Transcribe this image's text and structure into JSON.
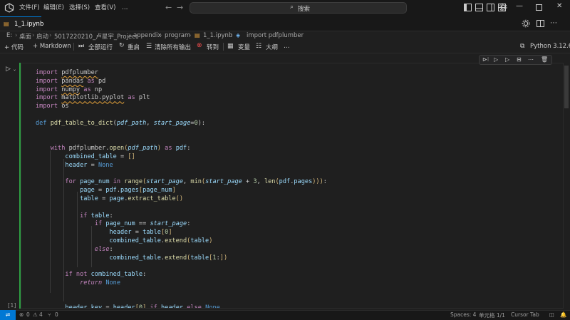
{
  "menu": [
    "文件(F)",
    "编辑(E)",
    "选择(S)",
    "查看(V)",
    "…"
  ],
  "search": {
    "placeholder": "搜索"
  },
  "tab": {
    "label": "1_1.ipynb"
  },
  "breadcrumb": [
    "E:",
    "桌面",
    "启动",
    "5017220210_卢星宇_Project",
    "appendix",
    "program",
    "1_1.ipynb",
    "import pdfplumber"
  ],
  "toolbar": {
    "add_code": "+ 代码",
    "add_markdown": "+ Markdown",
    "run_all": "全部运行",
    "restart": "重启",
    "clear_outputs": "清除所有输出",
    "goto": "转到",
    "variables": "变量",
    "outline": "大纲",
    "more": "…",
    "kernel": "Python 3.12.6"
  },
  "cell": {
    "exec_count": "[1]"
  },
  "code_lines": [
    [
      [
        "kw",
        "import "
      ],
      [
        "plain squig",
        "pdfplumber"
      ]
    ],
    [
      [
        "kw",
        "import "
      ],
      [
        "plain squig",
        "pandas"
      ],
      [
        "kw",
        " as "
      ],
      [
        "plain",
        "pd"
      ]
    ],
    [
      [
        "kw",
        "import "
      ],
      [
        "plain squig",
        "numpy"
      ],
      [
        "kw",
        " as "
      ],
      [
        "plain",
        "np"
      ]
    ],
    [
      [
        "kw",
        "import "
      ],
      [
        "plain squig",
        "matplotlib.pyplot"
      ],
      [
        "kw",
        " as "
      ],
      [
        "plain",
        "plt"
      ]
    ],
    [
      [
        "kw",
        "import "
      ],
      [
        "plain",
        "os"
      ]
    ],
    [],
    [
      [
        "kw2",
        "def "
      ],
      [
        "fn",
        "pdf_table_to_dict"
      ],
      [
        "plain",
        "("
      ],
      [
        "var it",
        "pdf_path"
      ],
      [
        "plain",
        ", "
      ],
      [
        "var it",
        "start_page"
      ],
      [
        "plain",
        "="
      ],
      [
        "num",
        "0"
      ],
      [
        "plain",
        "):"
      ]
    ],
    [],
    [],
    [
      [
        "plain",
        "    "
      ],
      [
        "kw",
        "with "
      ],
      [
        "plain",
        "pdfplumber."
      ],
      [
        "fn",
        "open"
      ],
      [
        "par",
        "("
      ],
      [
        "var it",
        "pdf_path"
      ],
      [
        "par",
        ")"
      ],
      [
        "kw",
        " as "
      ],
      [
        "var",
        "pdf"
      ],
      [
        "plain",
        ":"
      ]
    ],
    [
      [
        "plain",
        "        "
      ],
      [
        "var",
        "combined_table"
      ],
      [
        "plain",
        " = "
      ],
      [
        "par",
        "[]"
      ]
    ],
    [
      [
        "plain",
        "        "
      ],
      [
        "var",
        "header"
      ],
      [
        "plain",
        " = "
      ],
      [
        "kw2",
        "None"
      ]
    ],
    [],
    [
      [
        "plain",
        "        "
      ],
      [
        "kw",
        "for "
      ],
      [
        "var",
        "page_num"
      ],
      [
        "kw",
        " in "
      ],
      [
        "fn",
        "range"
      ],
      [
        "par",
        "("
      ],
      [
        "var it",
        "start_page"
      ],
      [
        "plain",
        ", "
      ],
      [
        "fn",
        "min"
      ],
      [
        "par",
        "("
      ],
      [
        "var it",
        "start_page"
      ],
      [
        "plain",
        " + "
      ],
      [
        "num",
        "3"
      ],
      [
        "plain",
        ", "
      ],
      [
        "fn",
        "len"
      ],
      [
        "par",
        "("
      ],
      [
        "var",
        "pdf"
      ],
      [
        "plain",
        "."
      ],
      [
        "var",
        "pages"
      ],
      [
        "par",
        ")))"
      ],
      [
        "plain",
        ":"
      ]
    ],
    [
      [
        "plain",
        "            "
      ],
      [
        "var",
        "page"
      ],
      [
        "plain",
        " = "
      ],
      [
        "var",
        "pdf"
      ],
      [
        "plain",
        "."
      ],
      [
        "var",
        "pages"
      ],
      [
        "par",
        "["
      ],
      [
        "var",
        "page_num"
      ],
      [
        "par",
        "]"
      ]
    ],
    [
      [
        "plain",
        "            "
      ],
      [
        "var",
        "table"
      ],
      [
        "plain",
        " = "
      ],
      [
        "var",
        "page"
      ],
      [
        "plain",
        "."
      ],
      [
        "fn",
        "extract_table"
      ],
      [
        "par",
        "()"
      ]
    ],
    [],
    [
      [
        "plain",
        "            "
      ],
      [
        "kw",
        "if "
      ],
      [
        "var",
        "table"
      ],
      [
        "plain",
        ":"
      ]
    ],
    [
      [
        "plain",
        "                "
      ],
      [
        "kw",
        "if "
      ],
      [
        "var",
        "page_num"
      ],
      [
        "plain",
        " == "
      ],
      [
        "var it",
        "start_page"
      ],
      [
        "plain",
        ":"
      ]
    ],
    [
      [
        "plain",
        "                    "
      ],
      [
        "var",
        "header"
      ],
      [
        "plain",
        " = "
      ],
      [
        "var",
        "table"
      ],
      [
        "par",
        "["
      ],
      [
        "num",
        "0"
      ],
      [
        "par",
        "]"
      ]
    ],
    [
      [
        "plain",
        "                    "
      ],
      [
        "var",
        "combined_table"
      ],
      [
        "plain",
        "."
      ],
      [
        "fn",
        "extend"
      ],
      [
        "par",
        "("
      ],
      [
        "var",
        "table"
      ],
      [
        "par",
        ")"
      ]
    ],
    [
      [
        "plain",
        "                "
      ],
      [
        "kw it",
        "else"
      ],
      [
        "plain",
        ":"
      ]
    ],
    [
      [
        "plain",
        "                    "
      ],
      [
        "var",
        "combined_table"
      ],
      [
        "plain",
        "."
      ],
      [
        "fn",
        "extend"
      ],
      [
        "par",
        "("
      ],
      [
        "var",
        "table"
      ],
      [
        "par",
        "["
      ],
      [
        "num",
        "1"
      ],
      [
        "plain",
        ":"
      ],
      [
        "par",
        "])"
      ]
    ],
    [],
    [
      [
        "plain",
        "        "
      ],
      [
        "kw",
        "if not "
      ],
      [
        "var",
        "combined_table"
      ],
      [
        "plain",
        ":"
      ]
    ],
    [
      [
        "plain",
        "            "
      ],
      [
        "kw it",
        "return "
      ],
      [
        "kw2",
        "None"
      ]
    ],
    [],
    [],
    [
      [
        "plain",
        "        "
      ],
      [
        "var",
        "header_key"
      ],
      [
        "plain",
        " = "
      ],
      [
        "var",
        "header"
      ],
      [
        "par",
        "["
      ],
      [
        "num",
        "0"
      ],
      [
        "par",
        "]"
      ],
      [
        "kw",
        " if "
      ],
      [
        "var",
        "header"
      ],
      [
        "kw",
        " else "
      ],
      [
        "kw2",
        "None"
      ]
    ]
  ],
  "status": {
    "errors": "0",
    "warnings": "4",
    "ports": "0",
    "spaces": "Spaces: 4",
    "cell": "单元格 1/1",
    "cursor_tab": "Cursor Tab"
  },
  "colors": {
    "accent": "#0078d4",
    "cell_border": "#2ea043",
    "squiggle": "#e5a23a"
  }
}
